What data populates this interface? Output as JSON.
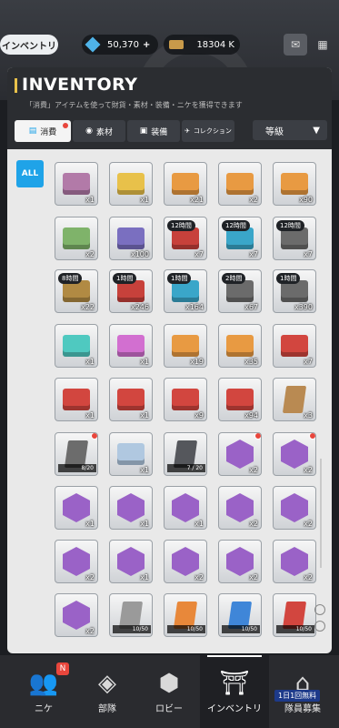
{
  "header": {
    "inventory_label": "インベントリ",
    "gems": "50,370",
    "credits": "18304 K"
  },
  "panel": {
    "title": "INVENTORY",
    "subtitle": "「消費」アイテムを使って財貨・素材・装備・ニケを獲得できます",
    "tabs": [
      {
        "label": "消費",
        "icon": "consumable-icon"
      },
      {
        "label": "素材",
        "icon": "material-icon"
      },
      {
        "label": "装備",
        "icon": "equipment-icon"
      },
      {
        "label": "コレクション",
        "icon": "collection-icon"
      }
    ],
    "sort_label": "等級",
    "filter_all": "ALL"
  },
  "items": [
    {
      "icon": "gift-box-icon",
      "color": "#b27aa8",
      "qty": "x1"
    },
    {
      "icon": "ribbon-box-icon",
      "color": "#e8c14a",
      "qty": "x1"
    },
    {
      "icon": "orange-crate-icon",
      "color": "#e89a42",
      "qty": "x21"
    },
    {
      "icon": "orange-crate-icon",
      "color": "#e89a42",
      "qty": "x2"
    },
    {
      "icon": "orange-crate-icon",
      "color": "#e89a42",
      "qty": "x90"
    },
    {
      "icon": "green-crate-icon",
      "color": "#7fb36a",
      "qty": "x2"
    },
    {
      "icon": "purple-crate-icon",
      "color": "#7a6fc0",
      "qty": "x100"
    },
    {
      "icon": "battery-pack-icon",
      "color": "#c7413b",
      "qty": "x7",
      "timer": "12時間"
    },
    {
      "icon": "battery-pack-icon",
      "color": "#3aa6c9",
      "qty": "x7",
      "timer": "12時間"
    },
    {
      "icon": "battery-pack-icon",
      "color": "#6b6b6b",
      "qty": "x7",
      "timer": "12時間"
    },
    {
      "icon": "battery-pack-icon",
      "color": "#b18a43",
      "qty": "x22",
      "timer": "8時間"
    },
    {
      "icon": "battery-pack-icon",
      "color": "#c7413b",
      "qty": "x246",
      "timer": "1時間"
    },
    {
      "icon": "battery-pack-icon",
      "color": "#3aa6c9",
      "qty": "x164",
      "timer": "1時間"
    },
    {
      "icon": "battery-pack-icon",
      "color": "#6b6b6b",
      "qty": "x67",
      "timer": "2時間"
    },
    {
      "icon": "battery-pack-icon",
      "color": "#6b6b6b",
      "qty": "x390",
      "timer": "1時間"
    },
    {
      "icon": "teal-crystal-crate-icon",
      "color": "#4fc9c0",
      "qty": "x1"
    },
    {
      "icon": "pink-crystal-crate-icon",
      "color": "#d26fd0",
      "qty": "x1"
    },
    {
      "icon": "orange-crate-icon",
      "color": "#e89a42",
      "qty": "x19"
    },
    {
      "icon": "orange-crate-icon",
      "color": "#e89a42",
      "qty": "x35"
    },
    {
      "icon": "red-crate-icon",
      "color": "#d2463f",
      "qty": "x7"
    },
    {
      "icon": "red-crate-icon",
      "color": "#d2463f",
      "qty": "x1"
    },
    {
      "icon": "red-crate-icon",
      "color": "#d2463f",
      "qty": "x1"
    },
    {
      "icon": "red-crate-icon",
      "color": "#d2463f",
      "qty": "x9"
    },
    {
      "icon": "red-crate-icon",
      "color": "#d2463f",
      "qty": "x94"
    },
    {
      "icon": "cardboard-box-icon",
      "color": "#b98a52",
      "qty": "x3"
    },
    {
      "icon": "dark-card-icon",
      "color": "#6c6c6c",
      "qty": "",
      "progress": "8/20",
      "dot": true
    },
    {
      "icon": "flower-stars-icon",
      "color": "#b0c8e0",
      "qty": "x1"
    },
    {
      "icon": "dark-card-icon",
      "color": "#55575c",
      "qty": "",
      "progress": "7 / 20"
    },
    {
      "icon": "nikke-portrait-icon",
      "color": "#9a62c7",
      "qty": "x2",
      "dot": true
    },
    {
      "icon": "nikke-portrait-icon",
      "color": "#9a62c7",
      "qty": "x2",
      "dot": true
    },
    {
      "icon": "nikke-portrait-icon",
      "color": "#9a62c7",
      "qty": "x1"
    },
    {
      "icon": "nikke-portrait-icon",
      "color": "#9a62c7",
      "qty": "x1"
    },
    {
      "icon": "nikke-portrait-icon",
      "color": "#9a62c7",
      "qty": "x1"
    },
    {
      "icon": "nikke-portrait-icon",
      "color": "#9a62c7",
      "qty": "x2"
    },
    {
      "icon": "nikke-portrait-icon",
      "color": "#9a62c7",
      "qty": "x2"
    },
    {
      "icon": "nikke-portrait-icon",
      "color": "#9a62c7",
      "qty": "x2"
    },
    {
      "icon": "nikke-portrait-icon",
      "color": "#9a62c7",
      "qty": "x1"
    },
    {
      "icon": "nikke-portrait-icon",
      "color": "#9a62c7",
      "qty": "x2"
    },
    {
      "icon": "nikke-portrait-icon",
      "color": "#9a62c7",
      "qty": "x2"
    },
    {
      "icon": "nikke-portrait-icon",
      "color": "#9a62c7",
      "qty": "x2"
    },
    {
      "icon": "nikke-portrait-icon",
      "color": "#9a62c7",
      "qty": "x2"
    },
    {
      "icon": "gray-card-icon",
      "color": "#9a9a9a",
      "qty": "",
      "progress": "10/50"
    },
    {
      "icon": "orange-card-icon",
      "color": "#e8883a",
      "qty": "",
      "progress": "10/50"
    },
    {
      "icon": "blue-card-icon",
      "color": "#3f86d8",
      "qty": "",
      "progress": "10/50"
    },
    {
      "icon": "red-card-icon",
      "color": "#d2463f",
      "qty": "",
      "progress": "10/50"
    }
  ],
  "nav": {
    "items": [
      {
        "label": "ニケ",
        "badge": "N",
        "icon": "nikke-icon"
      },
      {
        "label": "部隊",
        "icon": "squad-icon"
      },
      {
        "label": "ロビー",
        "icon": "lobby-icon"
      },
      {
        "label": "インベントリ",
        "icon": "inventory-icon"
      },
      {
        "label": "隊員募集",
        "icon": "recruit-icon",
        "banner": "1日1回無料"
      }
    ]
  }
}
